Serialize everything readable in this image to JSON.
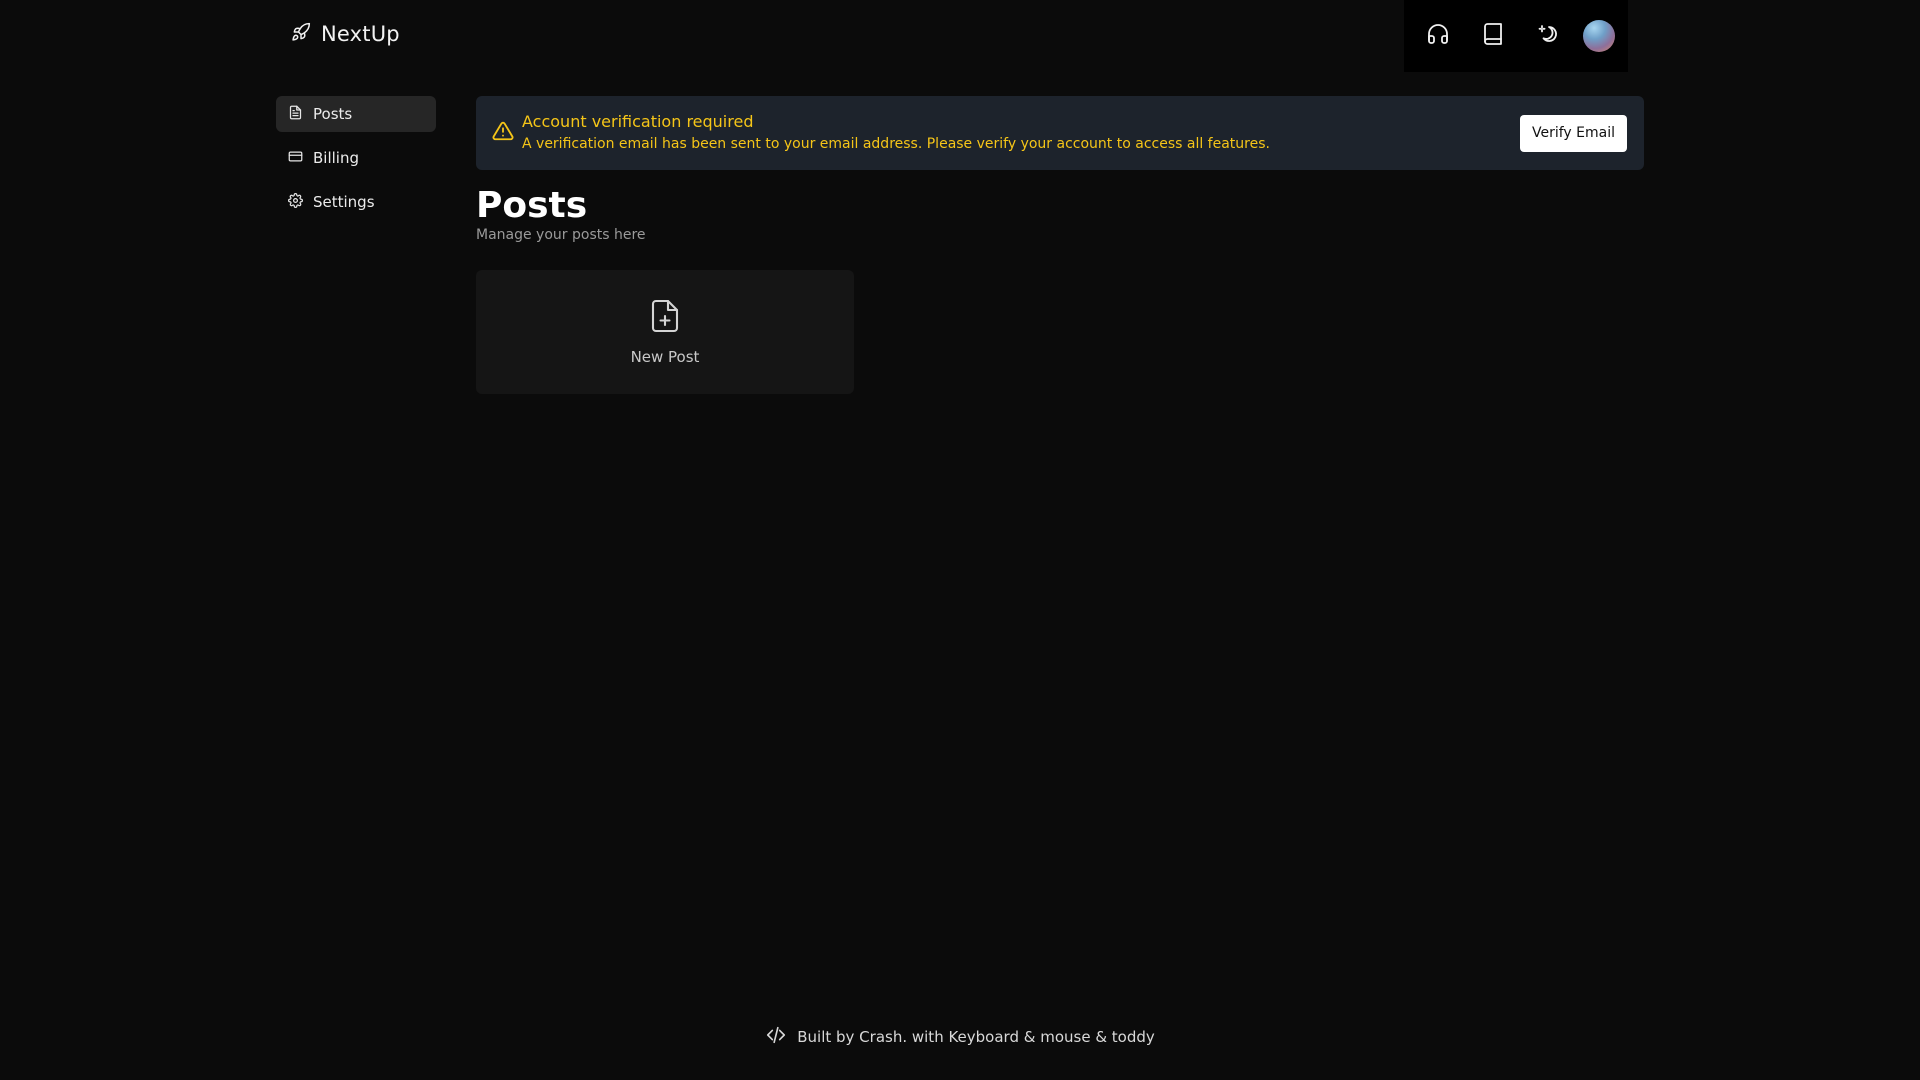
{
  "brand": {
    "name": "NextUp",
    "icon": "rocket-icon"
  },
  "toolbar": {
    "icons": [
      "headphones-icon",
      "book-icon",
      "theme-toggle-icon"
    ],
    "avatar": "avatar"
  },
  "sidebar": {
    "items": [
      {
        "label": "Posts",
        "icon": "file-text-icon",
        "active": true
      },
      {
        "label": "Billing",
        "icon": "credit-card-icon",
        "active": false
      },
      {
        "label": "Settings",
        "icon": "gear-icon",
        "active": false
      }
    ]
  },
  "alert": {
    "title": "Account verification required",
    "description": "A verification email has been sent to your email address. Please verify your account to access all features.",
    "button_label": "Verify Email",
    "color": "#f5c518",
    "background": "#1d232c"
  },
  "main": {
    "title": "Posts",
    "subtitle": "Manage your posts here",
    "new_post_label": "New Post"
  },
  "footer": {
    "text": "Built by Crash. with Keyboard & mouse & toddy",
    "icon": "code-icon"
  }
}
